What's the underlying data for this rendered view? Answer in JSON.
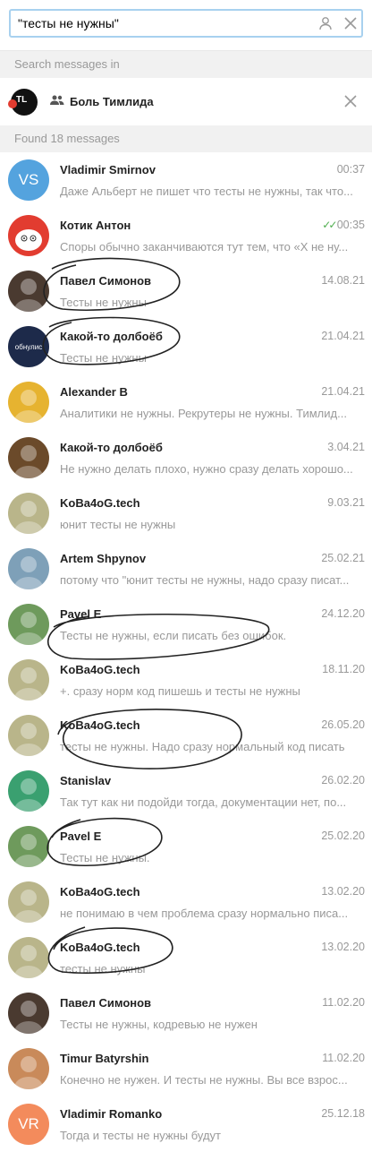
{
  "search": {
    "query": "\"тесты не нужны\""
  },
  "search_in_label": "Search messages in",
  "chat": {
    "name": "Боль Тимлида",
    "logo_text": "TL"
  },
  "found_label": "Found 18 messages",
  "messages": [
    {
      "sender": "Vladimir Smirnov",
      "date": "00:37",
      "preview": "Даже Альберт не пишет что тесты не нужны, так что...",
      "avatar": {
        "type": "initials",
        "text": "VS",
        "color": "#54a3de"
      }
    },
    {
      "sender": "Котик Антон",
      "date": "00:35",
      "read": true,
      "preview": "Споры обычно заканчиваются тут тем, что «Х не ну...",
      "avatar": {
        "type": "cat",
        "color": "#e23c30"
      }
    },
    {
      "sender": "Павел Симонов",
      "date": "14.08.21",
      "preview": "Тесты не нужны",
      "avatar": {
        "type": "photo",
        "color": "#4a3a30"
      }
    },
    {
      "sender": "Какой-то долбоёб",
      "date": "21.04.21",
      "preview": "Тесты не нужны",
      "avatar": {
        "type": "photo",
        "color": "#1d2a4a",
        "text": "обнулис"
      }
    },
    {
      "sender": "Alexander B",
      "date": "21.04.21",
      "preview": "Аналитики не нужны. Рекрутеры не нужны. Тимлид...",
      "avatar": {
        "type": "photo",
        "color": "#e6b330"
      }
    },
    {
      "sender": "Какой-то долбоёб",
      "date": "3.04.21",
      "preview": "Не нужно делать плохо, нужно сразу делать хорошо...",
      "avatar": {
        "type": "photo",
        "color": "#6b4a2a"
      }
    },
    {
      "sender": "KoBa4oG.tech",
      "date": "9.03.21",
      "preview": "юнит тесты не нужны",
      "avatar": {
        "type": "photo",
        "color": "#b9b58a"
      }
    },
    {
      "sender": "Artem Shpynov",
      "date": "25.02.21",
      "preview": "потому что \"юнит тесты не нужны, надо сразу писат...",
      "avatar": {
        "type": "photo",
        "color": "#7ea0b8"
      }
    },
    {
      "sender": "Pavel E",
      "date": "24.12.20",
      "preview": "Тесты не нужны, если писать без ошибок.",
      "avatar": {
        "type": "photo",
        "color": "#6e9a5c"
      }
    },
    {
      "sender": "KoBa4oG.tech",
      "date": "18.11.20",
      "preview": "+. сразу норм код пишешь и тесты не нужны",
      "avatar": {
        "type": "photo",
        "color": "#b9b58a"
      }
    },
    {
      "sender": "KoBa4oG.tech",
      "date": "26.05.20",
      "preview": "тесты не нужны. Надо сразу нормальный код писать",
      "avatar": {
        "type": "photo",
        "color": "#b9b58a"
      }
    },
    {
      "sender": "Stanislav",
      "date": "26.02.20",
      "preview": "Так тут как ни подойди тогда, документации нет, по...",
      "avatar": {
        "type": "photo",
        "color": "#3aa070"
      }
    },
    {
      "sender": "Pavel E",
      "date": "25.02.20",
      "preview": "Тесты не нужны.",
      "avatar": {
        "type": "photo",
        "color": "#6e9a5c"
      }
    },
    {
      "sender": "KoBa4oG.tech",
      "date": "13.02.20",
      "preview": "не понимаю в чем проблема сразу нормально писа...",
      "avatar": {
        "type": "photo",
        "color": "#b9b58a"
      }
    },
    {
      "sender": "KoBa4oG.tech",
      "date": "13.02.20",
      "preview": "тесты не нужны",
      "avatar": {
        "type": "photo",
        "color": "#b9b58a"
      }
    },
    {
      "sender": "Павел Симонов",
      "date": "11.02.20",
      "preview": "Тесты не нужны, кодревью не нужен",
      "avatar": {
        "type": "photo",
        "color": "#4a3a30"
      }
    },
    {
      "sender": "Timur Batyrshin",
      "date": "11.02.20",
      "preview": "Конечно не нужен. И тесты не нужны. Вы все взрос...",
      "avatar": {
        "type": "photo",
        "color": "#c98a5a"
      }
    },
    {
      "sender": "Vladimir Romanko",
      "date": "25.12.18",
      "preview": "Тогда и тесты не нужны будут",
      "avatar": {
        "type": "initials",
        "text": "VR",
        "color": "#f38b5c"
      }
    }
  ]
}
